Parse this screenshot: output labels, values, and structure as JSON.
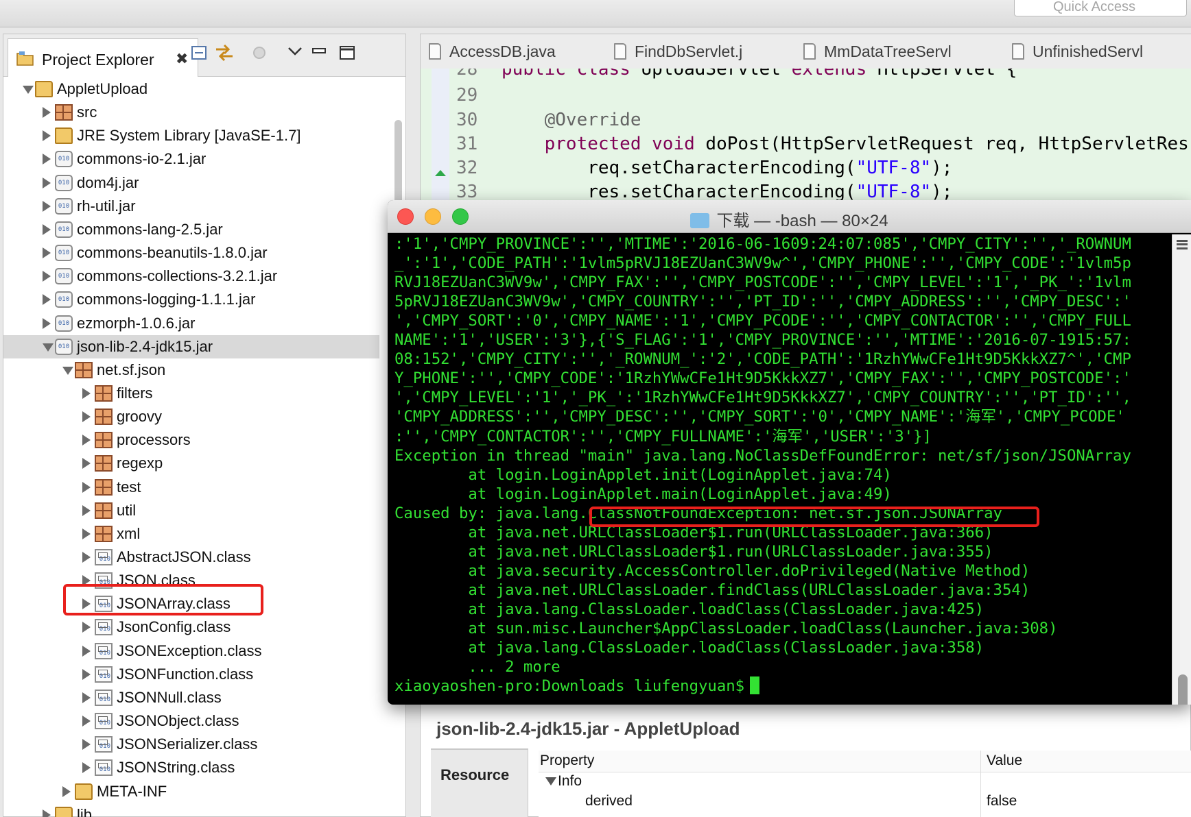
{
  "quick_access": "Quick Access",
  "explorer": {
    "title": "Project Explorer",
    "close": "✖"
  },
  "tree": [
    {
      "label": "AppletUpload",
      "indent": 0,
      "arrow": "down",
      "icon": "project-icon"
    },
    {
      "label": "src",
      "indent": 1,
      "arrow": "right",
      "icon": "source-folder-icon"
    },
    {
      "label": "JRE System Library [JavaSE-1.7]",
      "indent": 1,
      "arrow": "right",
      "icon": "library-icon"
    },
    {
      "label": "commons-io-2.1.jar",
      "indent": 1,
      "arrow": "right",
      "icon": "jar-icon"
    },
    {
      "label": "dom4j.jar",
      "indent": 1,
      "arrow": "right",
      "icon": "jar-icon"
    },
    {
      "label": "rh-util.jar",
      "indent": 1,
      "arrow": "right",
      "icon": "jar-icon"
    },
    {
      "label": "commons-lang-2.5.jar",
      "indent": 1,
      "arrow": "right",
      "icon": "jar-icon"
    },
    {
      "label": "commons-beanutils-1.8.0.jar",
      "indent": 1,
      "arrow": "right",
      "icon": "jar-icon"
    },
    {
      "label": "commons-collections-3.2.1.jar",
      "indent": 1,
      "arrow": "right",
      "icon": "jar-icon"
    },
    {
      "label": "commons-logging-1.1.1.jar",
      "indent": 1,
      "arrow": "right",
      "icon": "jar-icon"
    },
    {
      "label": "ezmorph-1.0.6.jar",
      "indent": 1,
      "arrow": "right",
      "icon": "jar-icon"
    },
    {
      "label": "json-lib-2.4-jdk15.jar",
      "indent": 1,
      "arrow": "down",
      "icon": "jar-icon",
      "selected": true
    },
    {
      "label": "net.sf.json",
      "indent": 2,
      "arrow": "down",
      "icon": "package-icon"
    },
    {
      "label": "filters",
      "indent": 3,
      "arrow": "right",
      "icon": "package-icon"
    },
    {
      "label": "groovy",
      "indent": 3,
      "arrow": "right",
      "icon": "package-icon"
    },
    {
      "label": "processors",
      "indent": 3,
      "arrow": "right",
      "icon": "package-icon"
    },
    {
      "label": "regexp",
      "indent": 3,
      "arrow": "right",
      "icon": "package-icon"
    },
    {
      "label": "test",
      "indent": 3,
      "arrow": "right",
      "icon": "package-icon"
    },
    {
      "label": "util",
      "indent": 3,
      "arrow": "right",
      "icon": "package-icon"
    },
    {
      "label": "xml",
      "indent": 3,
      "arrow": "right",
      "icon": "package-icon"
    },
    {
      "label": "AbstractJSON.class",
      "indent": 3,
      "arrow": "right",
      "icon": "class-file-icon"
    },
    {
      "label": "JSON.class",
      "indent": 3,
      "arrow": "right",
      "icon": "class-file-icon"
    },
    {
      "label": "JSONArray.class",
      "indent": 3,
      "arrow": "right",
      "icon": "class-file-icon"
    },
    {
      "label": "JsonConfig.class",
      "indent": 3,
      "arrow": "right",
      "icon": "class-file-icon"
    },
    {
      "label": "JSONException.class",
      "indent": 3,
      "arrow": "right",
      "icon": "class-file-icon"
    },
    {
      "label": "JSONFunction.class",
      "indent": 3,
      "arrow": "right",
      "icon": "class-file-icon"
    },
    {
      "label": "JSONNull.class",
      "indent": 3,
      "arrow": "right",
      "icon": "class-file-icon"
    },
    {
      "label": "JSONObject.class",
      "indent": 3,
      "arrow": "right",
      "icon": "class-file-icon"
    },
    {
      "label": "JSONSerializer.class",
      "indent": 3,
      "arrow": "right",
      "icon": "class-file-icon"
    },
    {
      "label": "JSONString.class",
      "indent": 3,
      "arrow": "right",
      "icon": "class-file-icon"
    },
    {
      "label": "META-INF",
      "indent": 2,
      "arrow": "right",
      "icon": "folder-icon"
    },
    {
      "label": "lib",
      "indent": 1,
      "arrow": "right",
      "icon": "folder-icon"
    }
  ],
  "editor": {
    "tabs": [
      "AccessDB.java",
      "FindDbServlet.j",
      "MmDataTreeServl",
      "UnfinishedServl"
    ],
    "lines": [
      {
        "n": "28",
        "code": "public class UploadServlet extends HttpServlet {"
      },
      {
        "n": "29",
        "code": ""
      },
      {
        "n": "30",
        "code": "    @Override"
      },
      {
        "n": "31",
        "code": "    protected void doPost(HttpServletRequest req, HttpServletRes"
      },
      {
        "n": "32",
        "code": "        req.setCharacterEncoding(\"UTF-8\");"
      },
      {
        "n": "33",
        "code": "        res.setCharacterEncoding(\"UTF-8\");"
      }
    ]
  },
  "terminal": {
    "title": "下载 — -bash — 80×24",
    "lines": [
      ":'1','CMPY_PROVINCE':'','MTIME':'2016-06-1609:24:07:085','CMPY_CITY':'','_ROWNUM",
      "_':'1','CODE_PATH':'1vlm5pRVJ18EZUanC3WV9w^','CMPY_PHONE':'','CMPY_CODE':'1vlm5p",
      "RVJ18EZUanC3WV9w','CMPY_FAX':'','CMPY_POSTCODE':'','CMPY_LEVEL':'1','_PK_':'1vlm",
      "5pRVJ18EZUanC3WV9w','CMPY_COUNTRY':'','PT_ID':'','CMPY_ADDRESS':'','CMPY_DESC':'",
      "','CMPY_SORT':'0','CMPY_NAME':'1','CMPY_PCODE':'','CMPY_CONTACTOR':'','CMPY_FULL",
      "NAME':'1','USER':'3'},{'S_FLAG':'1','CMPY_PROVINCE':'','MTIME':'2016-07-1915:57:",
      "08:152','CMPY_CITY':'','_ROWNUM_':'2','CODE_PATH':'1RzhYWwCFe1Ht9D5KkkXZ7^','CMP",
      "Y_PHONE':'','CMPY_CODE':'1RzhYWwCFe1Ht9D5KkkXZ7','CMPY_FAX':'','CMPY_POSTCODE':'",
      "','CMPY_LEVEL':'1','_PK_':'1RzhYWwCFe1Ht9D5KkkXZ7','CMPY_COUNTRY':'','PT_ID':'',",
      "'CMPY_ADDRESS':'','CMPY_DESC':'','CMPY_SORT':'0','CMPY_NAME':'海军','CMPY_PCODE'",
      ":'','CMPY_CONTACTOR':'','CMPY_FULLNAME':'海军','USER':'3'}]",
      "Exception in thread \"main\" java.lang.NoClassDefFoundError: net/sf/json/JSONArray",
      "        at login.LoginApplet.init(LoginApplet.java:74)",
      "        at login.LoginApplet.main(LoginApplet.java:49)",
      "Caused by: java.lang.ClassNotFoundException: net.sf.json.JSONArray",
      "        at java.net.URLClassLoader$1.run(URLClassLoader.java:366)",
      "        at java.net.URLClassLoader$1.run(URLClassLoader.java:355)",
      "        at java.security.AccessController.doPrivileged(Native Method)",
      "        at java.net.URLClassLoader.findClass(URLClassLoader.java:354)",
      "        at java.lang.ClassLoader.loadClass(ClassLoader.java:425)",
      "        at sun.misc.Launcher$AppClassLoader.loadClass(Launcher.java:308)",
      "        at java.lang.ClassLoader.loadClass(ClassLoader.java:358)",
      "        ... 2 more"
    ],
    "prompt": "xiaoyaoshen-pro:Downloads liufengyuan$"
  },
  "properties": {
    "title": "json-lib-2.4-jdk15.jar - AppletUpload",
    "resource_tab": "Resource",
    "col_property": "Property",
    "col_value": "Value",
    "group": "Info",
    "rows": [
      {
        "property": "derived",
        "value": "false"
      }
    ]
  }
}
